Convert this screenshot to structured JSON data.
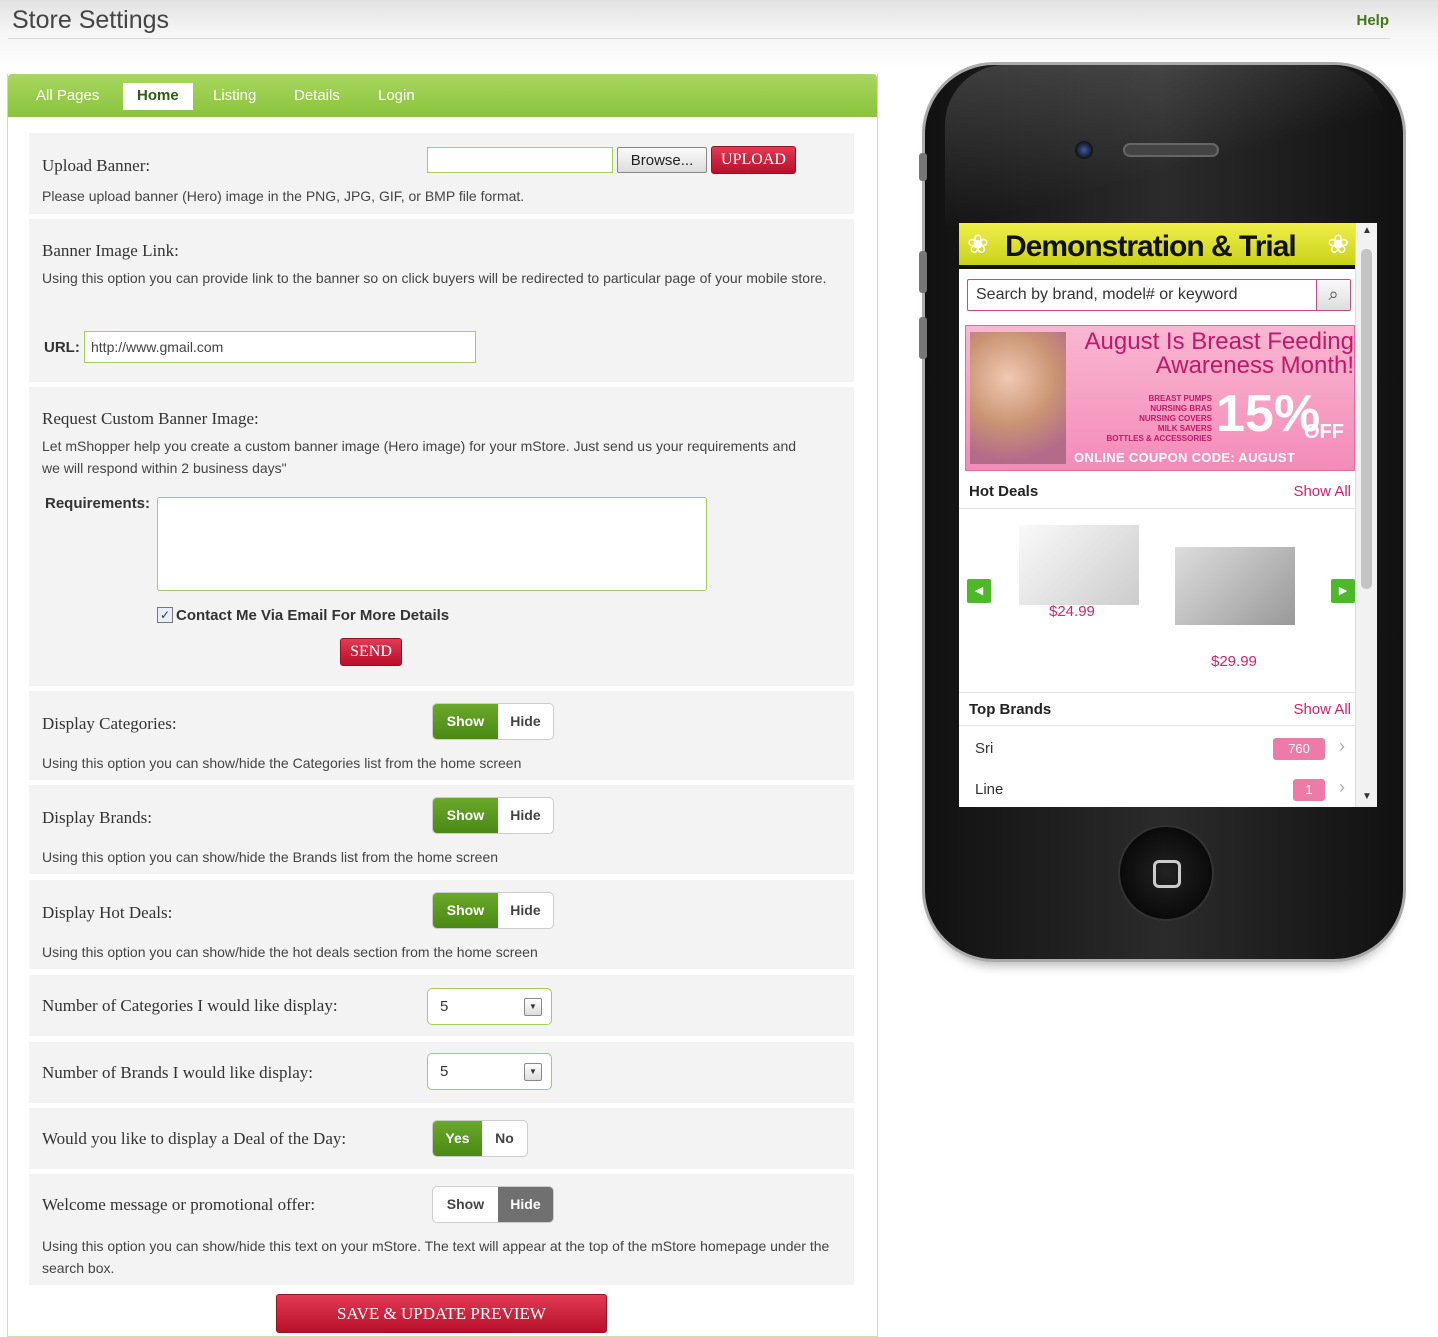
{
  "header": {
    "title": "Store Settings",
    "help": "Help"
  },
  "tabs": [
    {
      "label": "All Pages"
    },
    {
      "label": "Home",
      "active": true
    },
    {
      "label": "Listing"
    },
    {
      "label": "Details"
    },
    {
      "label": "Login"
    }
  ],
  "upload_banner": {
    "label": "Upload Banner:",
    "file_value": "",
    "browse": "Browse...",
    "upload": "UPLOAD",
    "desc": "Please upload banner (Hero) image in the PNG, JPG, GIF, or BMP file format."
  },
  "banner_link": {
    "label": "Banner Image Link:",
    "desc": "Using this option you can provide link to the banner so on click buyers will be redirected to particular page of your mobile store.",
    "url_label": "URL:",
    "url_value": "http://www.gmail.com"
  },
  "custom_banner": {
    "label": "Request Custom Banner Image:",
    "desc": "Let mShopper help you create a custom banner image (Hero image) for your mStore. Just send us your requirements and we will respond within 2 business days\"",
    "req_label": "Requirements:",
    "req_value": "",
    "contact_label": "Contact Me Via Email For More Details",
    "contact_checked": true,
    "send": "SEND"
  },
  "display_categories": {
    "label": "Display Categories:",
    "show": "Show",
    "hide": "Hide",
    "selected": "Show",
    "desc": "Using this option you can show/hide the Categories list from the home screen"
  },
  "display_brands": {
    "label": "Display Brands:",
    "show": "Show",
    "hide": "Hide",
    "selected": "Show",
    "desc": "Using this option you can show/hide the Brands list from the home screen"
  },
  "display_hot_deals": {
    "label": "Display Hot Deals:",
    "show": "Show",
    "hide": "Hide",
    "selected": "Show",
    "desc": "Using this option you can show/hide the hot deals section from the home screen"
  },
  "num_categories": {
    "label": "Number of Categories I would like display:",
    "value": "5"
  },
  "num_brands": {
    "label": "Number of Brands I would like display:",
    "value": "5"
  },
  "deal_of_day": {
    "label": "Would you like to display a Deal of the Day:",
    "yes": "Yes",
    "no": "No",
    "selected": "Yes"
  },
  "welcome": {
    "label": "Welcome message or promotional offer:",
    "show": "Show",
    "hide": "Hide",
    "selected": "Hide",
    "desc": "Using this option you can show/hide this text on your mStore. The text will appear at the top of the mStore homepage under the search box."
  },
  "save": "SAVE & UPDATE PREVIEW",
  "colors": {
    "accent_green": "#8ac43c",
    "accent_red": "#c8173a",
    "pink": "#d4236c"
  },
  "preview": {
    "store_title": "Demonstration & Trial",
    "search_placeholder": "Search by brand, model# or keyword",
    "promo": {
      "headline": "August Is Breast Feeding Awareness Month!",
      "items": [
        "BREAST PUMPS",
        "NURSING BRAS",
        "NURSING COVERS",
        "MILK SAVERS",
        "BOTTLES & ACCESSORIES"
      ],
      "discount": "15%",
      "off": "OFF",
      "coupon": "ONLINE COUPON CODE: AUGUST"
    },
    "hot_deals": {
      "title": "Hot Deals",
      "show_all": "Show All",
      "prices": [
        "$24.99",
        "$29.99"
      ]
    },
    "top_brands": {
      "title": "Top Brands",
      "show_all": "Show All",
      "items": [
        {
          "name": "Sri",
          "count": "760"
        },
        {
          "name": "Line",
          "count": "1"
        }
      ]
    }
  }
}
